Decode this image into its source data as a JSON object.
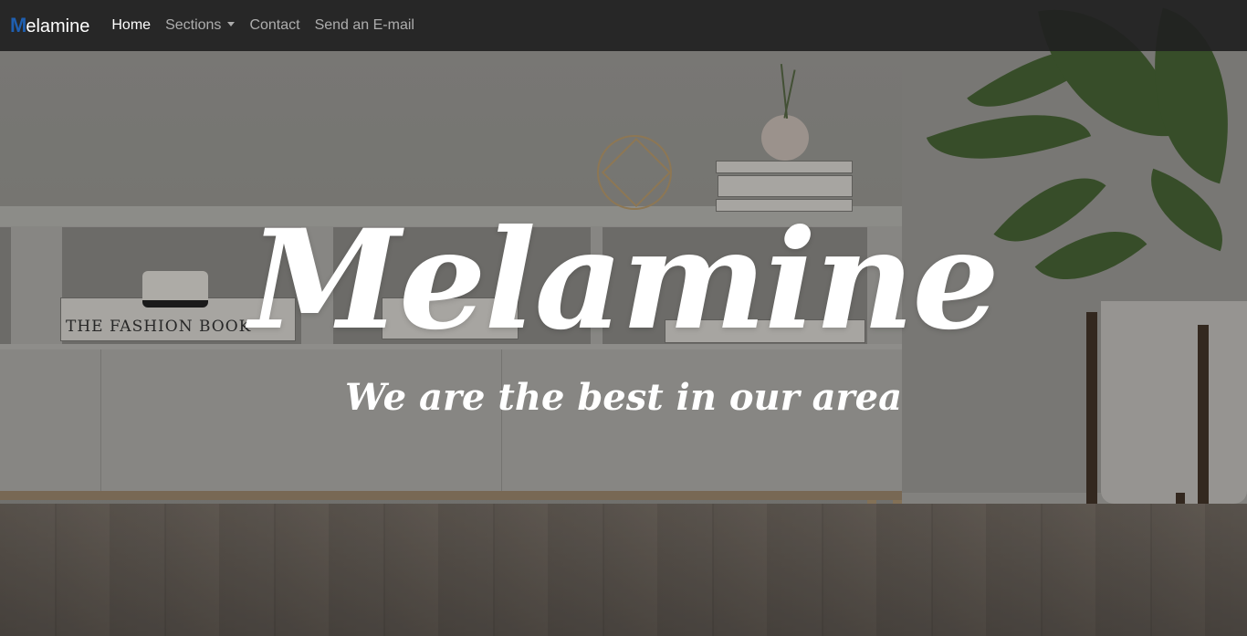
{
  "navbar": {
    "brand": {
      "mark": "M",
      "rest": "elamine"
    },
    "links": [
      {
        "label": "Home"
      },
      {
        "label": "Sections"
      },
      {
        "label": "Contact"
      },
      {
        "label": "Send an E-mail"
      }
    ]
  },
  "hero": {
    "title": "Melamine",
    "subtitle": "We are the best in our area",
    "book_title": "THE FASHION BOOK"
  },
  "colors": {
    "navbar_bg": "#212121",
    "brand_mark": "#1f5fb0",
    "active_link": "#ffffff",
    "link": "rgba(255,255,255,0.62)"
  }
}
